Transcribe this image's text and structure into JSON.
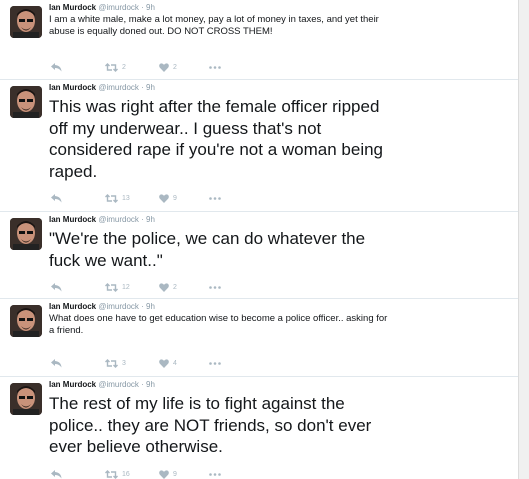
{
  "tweets": [
    {
      "author": "Ian Murdock",
      "handle": "@imurdock",
      "time": "· 9h",
      "text": "I am a white male, make a lot money, pay a lot of money in taxes, and yet their abuse is equally doned out. DO NOT CROSS THEM!",
      "size": "small",
      "retweets": "2",
      "likes": "2"
    },
    {
      "author": "Ian Murdock",
      "handle": "@imurdock",
      "time": "· 9h",
      "text": "This was right after the female officer ripped off my underwear.. I guess that's not considered rape if you're not a woman being raped.",
      "size": "large",
      "retweets": "13",
      "likes": "9"
    },
    {
      "author": "Ian Murdock",
      "handle": "@imurdock",
      "time": "· 9h",
      "text": "\"We're the police, we can do whatever the fuck we want..\"",
      "size": "large",
      "retweets": "12",
      "likes": "2"
    },
    {
      "author": "Ian Murdock",
      "handle": "@imurdock",
      "time": "· 9h",
      "text": "What does one have to get education wise to become a police officer.. asking for a friend.",
      "size": "small",
      "retweets": "3",
      "likes": "4"
    },
    {
      "author": "Ian Murdock",
      "handle": "@imurdock",
      "time": "· 9h",
      "text": "The rest of my life is to fight against the police.. they are NOT friends, so don't ever ever believe otherwise.",
      "size": "large",
      "retweets": "16",
      "likes": "9"
    }
  ],
  "icons": {
    "reply": "reply-icon",
    "retweet": "retweet-icon",
    "like": "heart-icon",
    "more": "more-icon"
  },
  "colors": {
    "icon": "#aab8c2",
    "meta": "#8899a6",
    "divider": "#e1e8ed"
  }
}
